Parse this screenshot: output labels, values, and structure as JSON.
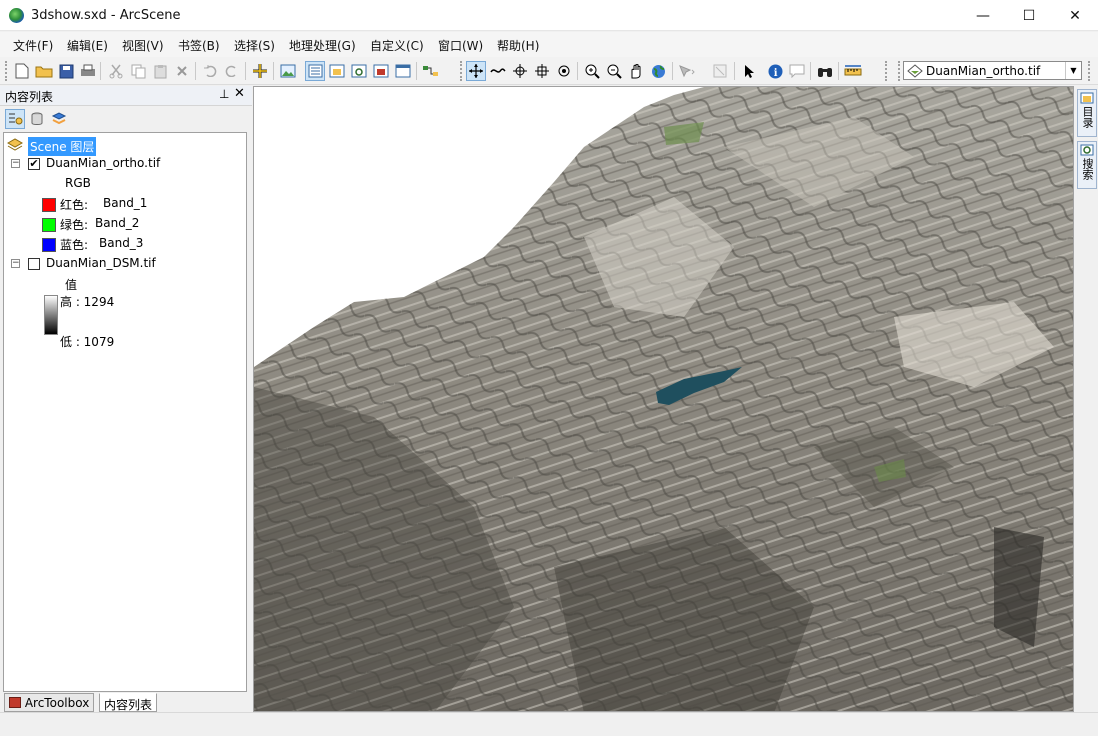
{
  "window": {
    "title": "3dshow.sxd - ArcScene",
    "minimize": "—",
    "maximize": "☐",
    "close": "✕"
  },
  "menu": [
    "文件(F)",
    "编辑(E)",
    "视图(V)",
    "书签(B)",
    "选择(S)",
    "地理处理(G)",
    "自定义(C)",
    "窗口(W)",
    "帮助(H)"
  ],
  "toolbar": {
    "layer_select_value": "DuanMian_ortho.tif"
  },
  "toc": {
    "title": "内容列表",
    "pin": "⊥",
    "close": "✕",
    "root_label": "Scene 图层",
    "layers": [
      {
        "name": "DuanMian_ortho.tif",
        "checked": "✔",
        "expander": "−",
        "legend_title": "RGB",
        "bands": [
          {
            "label": "红色:",
            "band": "Band_1",
            "color": "#ff0000"
          },
          {
            "label": "绿色:",
            "band": "Band_2",
            "color": "#00ff00"
          },
          {
            "label": "蓝色:",
            "band": "Band_3",
            "color": "#0000ff"
          }
        ]
      },
      {
        "name": "DuanMian_DSM.tif",
        "checked": "",
        "expander": "−",
        "legend_title": "值",
        "high": "高 : 1294",
        "low": "低 : 1079"
      }
    ],
    "tabs": [
      "ArcToolbox",
      "内容列表"
    ]
  },
  "dock": {
    "catalog": "目录",
    "search": "搜索"
  },
  "colors": {
    "selection": "#3399ff",
    "water": "#1f4f5e"
  }
}
